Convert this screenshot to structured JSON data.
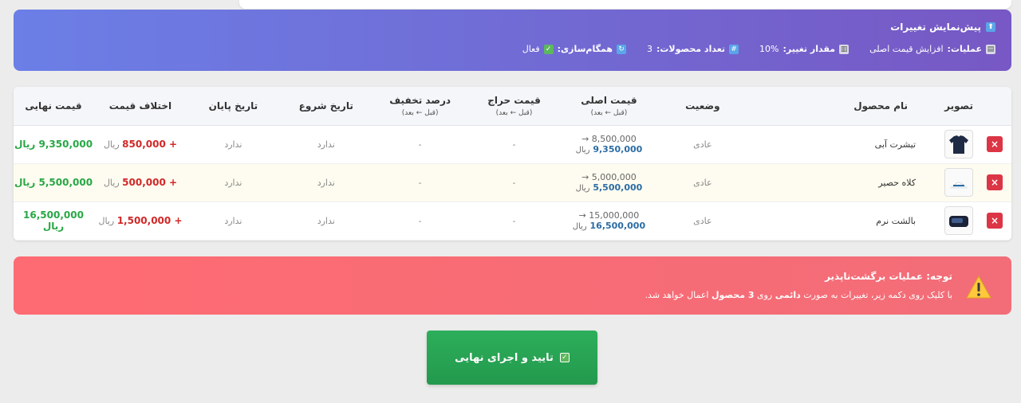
{
  "preview": {
    "title": "پیش‌نمایش تغییرات",
    "operation_label": "عملیات:",
    "operation_value": "افزایش قیمت اصلی",
    "change_label": "مقدار تغییر:",
    "change_value": "10%",
    "count_label": "تعداد محصولات:",
    "count_value": "3",
    "sync_label": "همگام‌سازی:",
    "sync_value": "فعال"
  },
  "table": {
    "headers": {
      "image": "تصویر",
      "name": "نام محصول",
      "status": "وضعیت",
      "price": "قیمت اصلی",
      "sale": "قیمت حراج",
      "discount": "درصد تخفیف",
      "before_after": "(قبل ← بعد)",
      "start": "تاریخ شروع",
      "end": "تاریخ پایان",
      "diff": "اختلاف قیمت",
      "final": "قیمت نهایی"
    },
    "rows": [
      {
        "name": "تیشرت آبی",
        "status": "عادی",
        "old_price": "8,500,000 →",
        "new_price": "9,350,000",
        "sale": "-",
        "discount": "-",
        "start": "ندارد",
        "end": "ندارد",
        "diff": "+ 850,000",
        "final": "9,350,000 ریال"
      },
      {
        "name": "کلاه حصیر",
        "status": "عادی",
        "old_price": "5,000,000 →",
        "new_price": "5,500,000",
        "sale": "-",
        "discount": "-",
        "start": "ندارد",
        "end": "ندارد",
        "diff": "+ 500,000",
        "final": "5,500,000 ریال"
      },
      {
        "name": "بالشت نرم",
        "status": "عادی",
        "old_price": "15,000,000 →",
        "new_price": "16,500,000",
        "sale": "-",
        "discount": "-",
        "start": "ندارد",
        "end": "ندارد",
        "diff": "+ 1,500,000",
        "final": "16,500,000 ریال"
      }
    ],
    "currency": "ریال",
    "delete_glyph": "×"
  },
  "warning": {
    "title": "توجه: عملیات برگشت‌ناپذیر",
    "text_1": "با کلیک روی دکمه زیر، تغییرات به صورت",
    "text_bold_1": "دائمی",
    "text_2": "روی",
    "text_bold_2": "3 محصول",
    "text_3": "اعمال خواهد شد."
  },
  "confirm_button": "تایید و اجرای نهایی",
  "colors": {
    "accent_gradient_start": "#6b7fe6",
    "accent_gradient_end": "#7758c4",
    "danger": "#dc3545",
    "success": "#28a745",
    "warning_bg": "#ff6b72"
  }
}
